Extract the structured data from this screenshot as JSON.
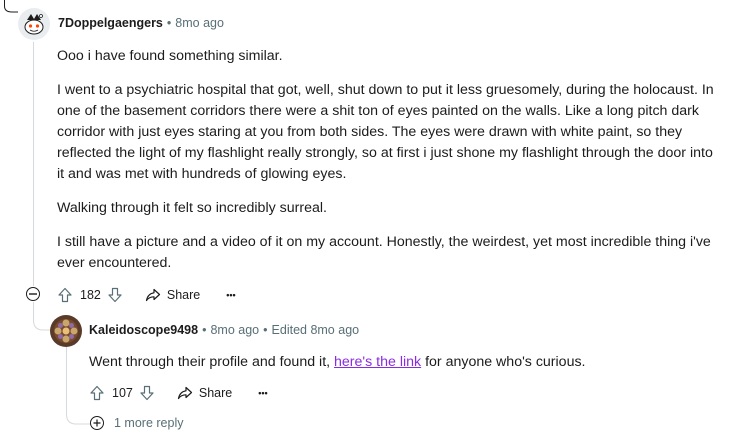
{
  "comment": {
    "author": "7Doppelgaengers",
    "separator": "•",
    "age": "8mo ago",
    "paragraphs": [
      "Ooo i have found something similar.",
      "I went to a psychiatric hospital that got, well, shut down to put it less gruesomely, during the holocaust. In one of the basement corridors there were a shit ton of eyes painted on the walls. Like a long pitch dark corridor with just eyes staring at you from both sides. The eyes were drawn with white paint, so they reflected the light of my flashlight really strongly, so at first i just shone my flashlight through the door into it and was met with hundreds of glowing eyes.",
      "Walking through it felt so incredibly surreal.",
      "I still have a picture and a video of it on my account. Honestly, the weirdest, yet most incredible thing i've ever encountered."
    ],
    "score": "182",
    "share_label": "Share",
    "more_label": "•••"
  },
  "reply": {
    "author": "Kaleidoscope9498",
    "separator": "•",
    "age": "8mo ago",
    "edited": "Edited 8mo ago",
    "text_before": "Went through their profile and found it, ",
    "link_text": "here's the link",
    "text_after": " for anyone who's curious.",
    "score": "107",
    "share_label": "Share",
    "more_label": "•••"
  },
  "more_replies_label": "1 more reply"
}
